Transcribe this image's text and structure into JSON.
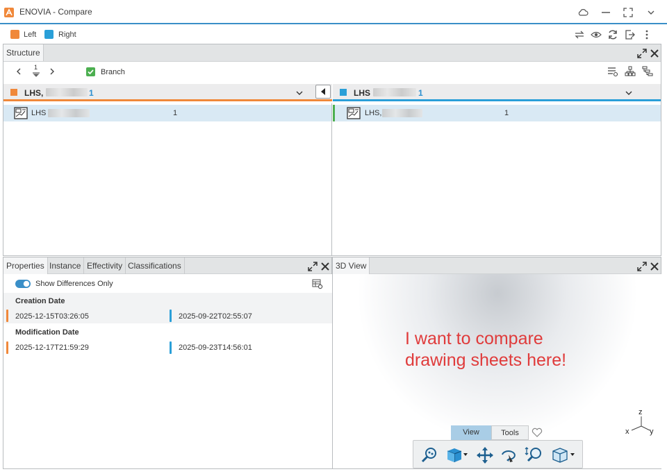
{
  "window": {
    "title": "ENOVIA - Compare"
  },
  "legend": {
    "left_label": "Left",
    "right_label": "Right",
    "left_color": "#f0883a",
    "right_color": "#2a9fd8"
  },
  "structure": {
    "tab_label": "Structure",
    "level_value": "1",
    "branch_label": "Branch",
    "left": {
      "title": "LHS,",
      "count": "1",
      "row_label": "LHS",
      "row_value": "1"
    },
    "right": {
      "title": "LHS",
      "count": "1",
      "row_label": "LHS,",
      "row_value": "1"
    }
  },
  "properties": {
    "tabs": [
      "Properties",
      "Instance",
      "Effectivity",
      "Classifications"
    ],
    "show_diff_label": "Show Differences Only",
    "groups": [
      {
        "label": "Creation Date",
        "left": "2025-12-15T03:26:05",
        "right": "2025-09-22T02:55:07"
      },
      {
        "label": "Modification Date",
        "left": "2025-12-17T21:59:29",
        "right": "2025-09-23T14:56:01"
      }
    ]
  },
  "view3d": {
    "tab_label": "3D View",
    "annotation_line1": "I want to compare",
    "annotation_line2": "drawing sheets here!",
    "axes": {
      "z": "z",
      "x": "x",
      "y": "y"
    },
    "toolbar_tabs": [
      "View",
      "Tools"
    ]
  },
  "icons": [
    "app-logo-icon",
    "cloud-icon",
    "minimize-icon",
    "fullscreen-icon",
    "chevron-down-icon",
    "swap-icon",
    "eye-icon",
    "refresh-icon",
    "export-icon",
    "more-vertical-icon",
    "maximize-icon",
    "close-icon",
    "chevron-left-icon",
    "chevron-right-icon",
    "checkbox-checked-icon",
    "list-filter-icon",
    "tree-icon",
    "hierarchy-icon",
    "collapse-left-icon",
    "part-icon",
    "table-settings-icon",
    "zoom-icon",
    "cube-icon",
    "pan-icon",
    "rotate-icon",
    "zoom-area-icon",
    "wireframe-cube-icon",
    "heart-icon"
  ]
}
